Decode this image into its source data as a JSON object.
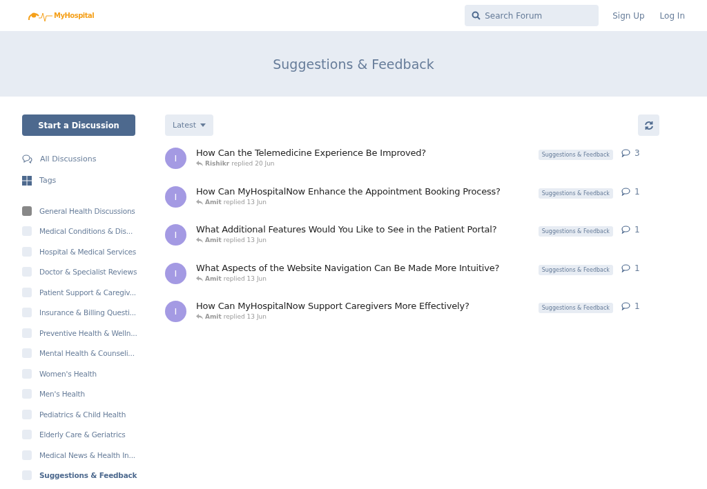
{
  "header": {
    "logo": "MyHospital",
    "search": {
      "placeholder": "Search Forum"
    },
    "links": [
      "Sign Up",
      "Log In"
    ]
  },
  "hero": {
    "title": "Suggestions & Feedback"
  },
  "sidebar": {
    "start_button": "Start a Discussion",
    "nav": [
      {
        "kind": "discussions",
        "label": "All Discussions"
      },
      {
        "kind": "tags",
        "label": "Tags"
      }
    ],
    "categories": [
      {
        "label": "General Health Discussions",
        "color": "#888888",
        "selected": false
      },
      {
        "label": "Medical Conditions & Dis...",
        "color": "#e7ecf3",
        "selected": false
      },
      {
        "label": "Hospital & Medical Services",
        "color": "#e7ecf3",
        "selected": false
      },
      {
        "label": "Doctor & Specialist Reviews",
        "color": "#e7ecf3",
        "selected": false
      },
      {
        "label": "Patient Support & Caregiv...",
        "color": "#e7ecf3",
        "selected": false
      },
      {
        "label": "Insurance & Billing Questi...",
        "color": "#e7ecf3",
        "selected": false
      },
      {
        "label": "Preventive Health & Welln...",
        "color": "#e7ecf3",
        "selected": false
      },
      {
        "label": "Mental Health & Counseli...",
        "color": "#e7ecf3",
        "selected": false
      },
      {
        "label": "Women's Health",
        "color": "#e7ecf3",
        "selected": false
      },
      {
        "label": "Men's Health",
        "color": "#e7ecf3",
        "selected": false
      },
      {
        "label": "Pediatrics & Child Health",
        "color": "#e7ecf3",
        "selected": false
      },
      {
        "label": "Elderly Care & Geriatrics",
        "color": "#e7ecf3",
        "selected": false
      },
      {
        "label": "Medical News & Health In...",
        "color": "#e7ecf3",
        "selected": false
      },
      {
        "label": "Suggestions & Feedback",
        "color": "#e7ecf3",
        "selected": true
      }
    ]
  },
  "toolbar": {
    "sort": "Latest"
  },
  "discussions": [
    {
      "avatar": "I",
      "title": "How Can the Telemedicine Experience Be Improved?",
      "user": "Rishikr",
      "meta": "replied 20 Jun",
      "tag": "Suggestions & Feedback",
      "replies": "3"
    },
    {
      "avatar": "I",
      "title": "How Can MyHospitalNow Enhance the Appointment Booking Process?",
      "user": "Amit",
      "meta": "replied 13 Jun",
      "tag": "Suggestions & Feedback",
      "replies": "1"
    },
    {
      "avatar": "I",
      "title": "What Additional Features Would You Like to See in the Patient Portal?",
      "user": "Amit",
      "meta": "replied 13 Jun",
      "tag": "Suggestions & Feedback",
      "replies": "1"
    },
    {
      "avatar": "I",
      "title": "What Aspects of the Website Navigation Can Be Made More Intuitive?",
      "user": "Amit",
      "meta": "replied 13 Jun",
      "tag": "Suggestions & Feedback",
      "replies": "1"
    },
    {
      "avatar": "I",
      "title": "How Can MyHospitalNow Support Caregivers More Effectively?",
      "user": "Amit",
      "meta": "replied 13 Jun",
      "tag": "Suggestions & Feedback",
      "replies": "1"
    }
  ]
}
